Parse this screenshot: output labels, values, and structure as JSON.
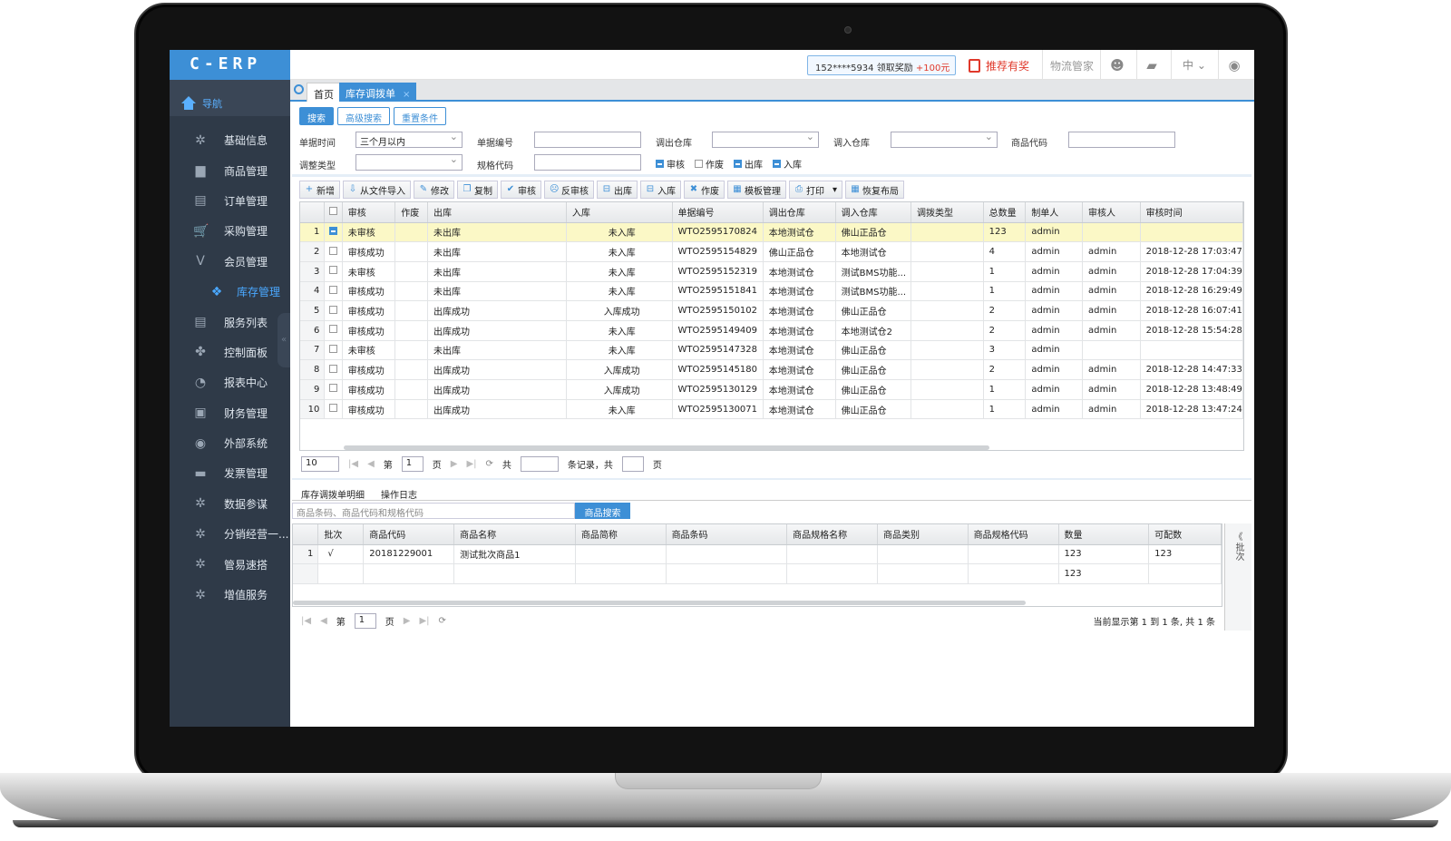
{
  "app": {
    "logo": "C-ERP",
    "nav_title": "导航"
  },
  "sidebar": {
    "items": [
      {
        "label": "基础信息",
        "icon": "gear-icon",
        "glyph": "✲"
      },
      {
        "label": "商品管理",
        "icon": "box-icon",
        "glyph": "▆"
      },
      {
        "label": "订单管理",
        "icon": "document-icon",
        "glyph": "▤"
      },
      {
        "label": "采购管理",
        "icon": "cart-icon",
        "glyph": "🛒"
      },
      {
        "label": "会员管理",
        "icon": "v-icon",
        "glyph": "V"
      },
      {
        "label": "库存管理",
        "icon": "inventory-icon",
        "glyph": "❖",
        "active": true
      },
      {
        "label": "服务列表",
        "icon": "list-icon",
        "glyph": "▤"
      },
      {
        "label": "控制面板",
        "icon": "dashboard-icon",
        "glyph": "✤"
      },
      {
        "label": "报表中心",
        "icon": "pie-chart-icon",
        "glyph": "◔"
      },
      {
        "label": "财务管理",
        "icon": "finance-icon",
        "glyph": "▣"
      },
      {
        "label": "外部系统",
        "icon": "external-icon",
        "glyph": "◉"
      },
      {
        "label": "发票管理",
        "icon": "invoice-icon",
        "glyph": "▬"
      },
      {
        "label": "数据参谋",
        "icon": "gear-icon",
        "glyph": "✲"
      },
      {
        "label": "分销经营一...",
        "icon": "gear-icon",
        "glyph": "✲"
      },
      {
        "label": "管易速搭",
        "icon": "gear-icon",
        "glyph": "✲"
      },
      {
        "label": "增值服务",
        "icon": "gear-icon",
        "glyph": "✲"
      }
    ]
  },
  "topbar": {
    "promo_text": "152****5934 领取奖励 ",
    "promo_plus": "+100元",
    "recommend": "推荐有奖",
    "logistics": "物流管家",
    "lang": "中"
  },
  "tabs": {
    "home": "首页",
    "active": "库存调拨单",
    "close": "×"
  },
  "search_buttons": {
    "search": "搜索",
    "advanced": "高级搜索",
    "reset": "重置条件"
  },
  "form": {
    "doc_time_label": "单据时间",
    "doc_time_value": "三个月以内",
    "doc_no_label": "单据编号",
    "doc_no_value": "",
    "out_wh_label": "调出仓库",
    "out_wh_value": "",
    "in_wh_label": "调入仓库",
    "in_wh_value": "",
    "item_code_label": "商品代码",
    "item_code_value": "",
    "adjust_type_label": "调整类型",
    "adjust_type_value": "",
    "spec_code_label": "规格代码",
    "spec_code_value": "",
    "checks": [
      {
        "label": "审核",
        "on": true
      },
      {
        "label": "作废",
        "on": false
      },
      {
        "label": "出库",
        "on": true
      },
      {
        "label": "入库",
        "on": true
      }
    ]
  },
  "toolbar": [
    {
      "label": "新增",
      "icon": "plus-icon",
      "glyph": "+"
    },
    {
      "label": "从文件导入",
      "icon": "import-icon",
      "glyph": "⇩"
    },
    {
      "label": "修改",
      "icon": "edit-icon",
      "glyph": "✎"
    },
    {
      "label": "复制",
      "icon": "copy-icon",
      "glyph": "❐"
    },
    {
      "label": "审核",
      "icon": "approve-icon",
      "glyph": "✔"
    },
    {
      "label": "反审核",
      "icon": "unapprove-icon",
      "glyph": "☹"
    },
    {
      "label": "出库",
      "icon": "outbound-icon",
      "glyph": "⊟"
    },
    {
      "label": "入库",
      "icon": "inbound-icon",
      "glyph": "⊟"
    },
    {
      "label": "作废",
      "icon": "void-icon",
      "glyph": "✖"
    },
    {
      "label": "模板管理",
      "icon": "template-icon",
      "glyph": "▦"
    },
    {
      "label": "打印",
      "icon": "print-icon",
      "glyph": "⎙"
    },
    {
      "label": "恢复布局",
      "icon": "layout-icon",
      "glyph": "▦"
    }
  ],
  "grid": {
    "columns": [
      "",
      "",
      "审核",
      "作废",
      "出库",
      "入库",
      "单据编号",
      "调出仓库",
      "调入仓库",
      "调拨类型",
      "总数量",
      "制单人",
      "审核人",
      "审核时间"
    ],
    "rows": [
      [
        "1",
        true,
        "未审核",
        "",
        "未出库",
        "未入库",
        "WTO2595170824",
        "本地测试仓",
        "佛山正品仓",
        "",
        "123",
        "admin",
        "",
        ""
      ],
      [
        "2",
        false,
        "审核成功",
        "",
        "未出库",
        "未入库",
        "WTO2595154829",
        "佛山正品仓",
        "本地测试仓",
        "",
        "4",
        "admin",
        "admin",
        "2018-12-28 17:03:47"
      ],
      [
        "3",
        false,
        "未审核",
        "",
        "未出库",
        "未入库",
        "WTO2595152319",
        "本地测试仓",
        "测试BMS功能...",
        "",
        "1",
        "admin",
        "admin",
        "2018-12-28 17:04:39"
      ],
      [
        "4",
        false,
        "审核成功",
        "",
        "未出库",
        "未入库",
        "WTO2595151841",
        "本地测试仓",
        "测试BMS功能...",
        "",
        "1",
        "admin",
        "admin",
        "2018-12-28 16:29:49"
      ],
      [
        "5",
        false,
        "审核成功",
        "",
        "出库成功",
        "入库成功",
        "WTO2595150102",
        "本地测试仓",
        "佛山正品仓",
        "",
        "2",
        "admin",
        "admin",
        "2018-12-28 16:07:41"
      ],
      [
        "6",
        false,
        "审核成功",
        "",
        "出库成功",
        "未入库",
        "WTO2595149409",
        "本地测试仓",
        "本地测试仓2",
        "",
        "2",
        "admin",
        "admin",
        "2018-12-28 15:54:28"
      ],
      [
        "7",
        false,
        "未审核",
        "",
        "未出库",
        "未入库",
        "WTO2595147328",
        "本地测试仓",
        "佛山正品仓",
        "",
        "3",
        "admin",
        "",
        ""
      ],
      [
        "8",
        false,
        "审核成功",
        "",
        "出库成功",
        "入库成功",
        "WTO2595145180",
        "本地测试仓",
        "佛山正品仓",
        "",
        "2",
        "admin",
        "admin",
        "2018-12-28 14:47:33"
      ],
      [
        "9",
        false,
        "审核成功",
        "",
        "出库成功",
        "入库成功",
        "WTO2595130129",
        "本地测试仓",
        "佛山正品仓",
        "",
        "1",
        "admin",
        "admin",
        "2018-12-28 13:48:49"
      ],
      [
        "10",
        false,
        "审核成功",
        "",
        "出库成功",
        "未入库",
        "WTO2595130071",
        "本地测试仓",
        "佛山正品仓",
        "",
        "1",
        "admin",
        "admin",
        "2018-12-28 13:47:24"
      ]
    ]
  },
  "pager": {
    "page_size": "10",
    "page_prefix": "第",
    "page": "1",
    "page_suffix": "页",
    "total_prefix": "共",
    "total_value": "",
    "records_text": "条记录，共",
    "pages_value": "",
    "pages_suffix": "页"
  },
  "detail": {
    "tabs": [
      "库存调拨单明细",
      "操作日志"
    ],
    "search_placeholder": "商品条码、商品代码和规格代码",
    "search_button": "商品搜索",
    "columns": [
      "",
      "批次",
      "商品代码",
      "商品名称",
      "商品简称",
      "商品条码",
      "商品规格名称",
      "商品类别",
      "商品规格代码",
      "数量",
      "可配数"
    ],
    "rows": [
      [
        "1",
        "√",
        "20181229001",
        "测试批次商品1",
        "",
        "",
        "",
        "",
        "",
        "123",
        "123"
      ],
      [
        "",
        "",
        "",
        "",
        "",
        "",
        "",
        "",
        "",
        "123",
        ""
      ]
    ],
    "side_label": "批次",
    "pager_prefix": "第",
    "page": "1",
    "pager_suffix": "页",
    "summary": "当前显示第 1 到 1 条, 共 1 条"
  }
}
